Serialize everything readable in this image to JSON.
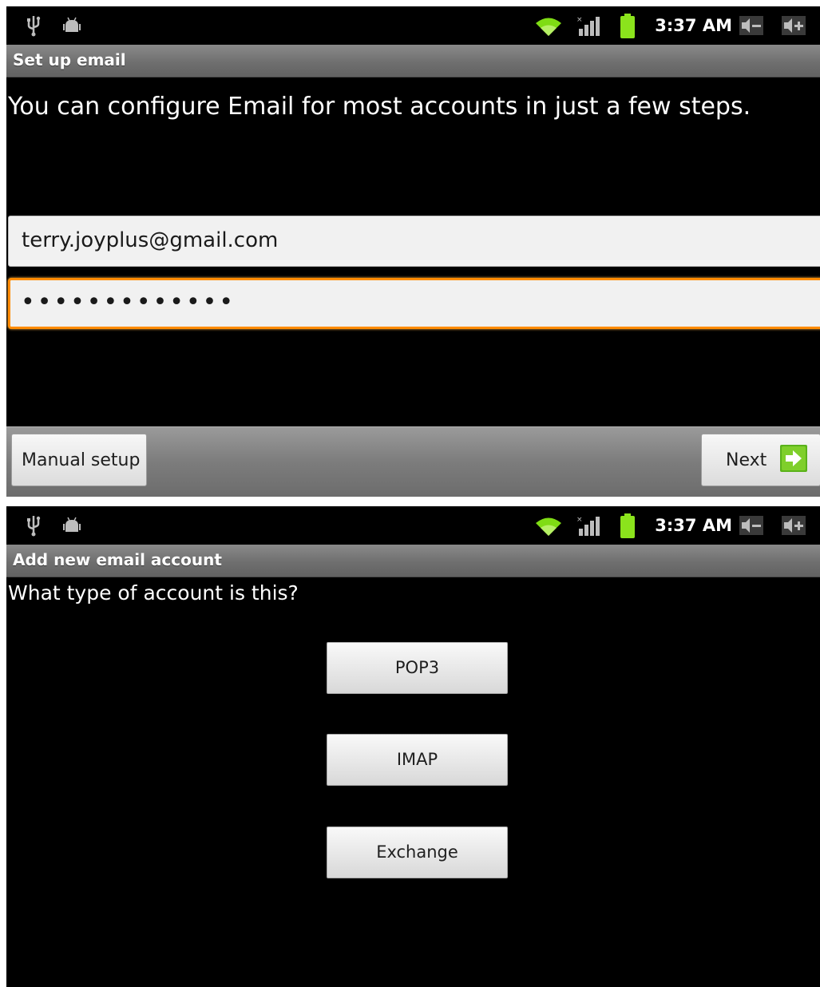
{
  "status_bar": {
    "time": "3:37 AM",
    "icons": [
      "usb-icon",
      "android-debug-icon",
      "wifi-icon",
      "signal-icon",
      "battery-icon",
      "volume-down-icon",
      "volume-up-icon"
    ],
    "accent_wifi": "#7fdc14",
    "accent_battery": "#8be31c"
  },
  "setup_screen": {
    "title": "Set up email",
    "intro": "You can configure Email for most accounts in just a few steps.",
    "email_value": "terry.joyplus@gmail.com",
    "password_value": "•••••••••••••",
    "manual_setup_label": "Manual setup",
    "next_label": "Next",
    "focus_color": "#ff8c00"
  },
  "account_type_screen": {
    "title": "Add new email account",
    "question": "What type of account is this?",
    "options": [
      "POP3",
      "IMAP",
      "Exchange"
    ]
  }
}
